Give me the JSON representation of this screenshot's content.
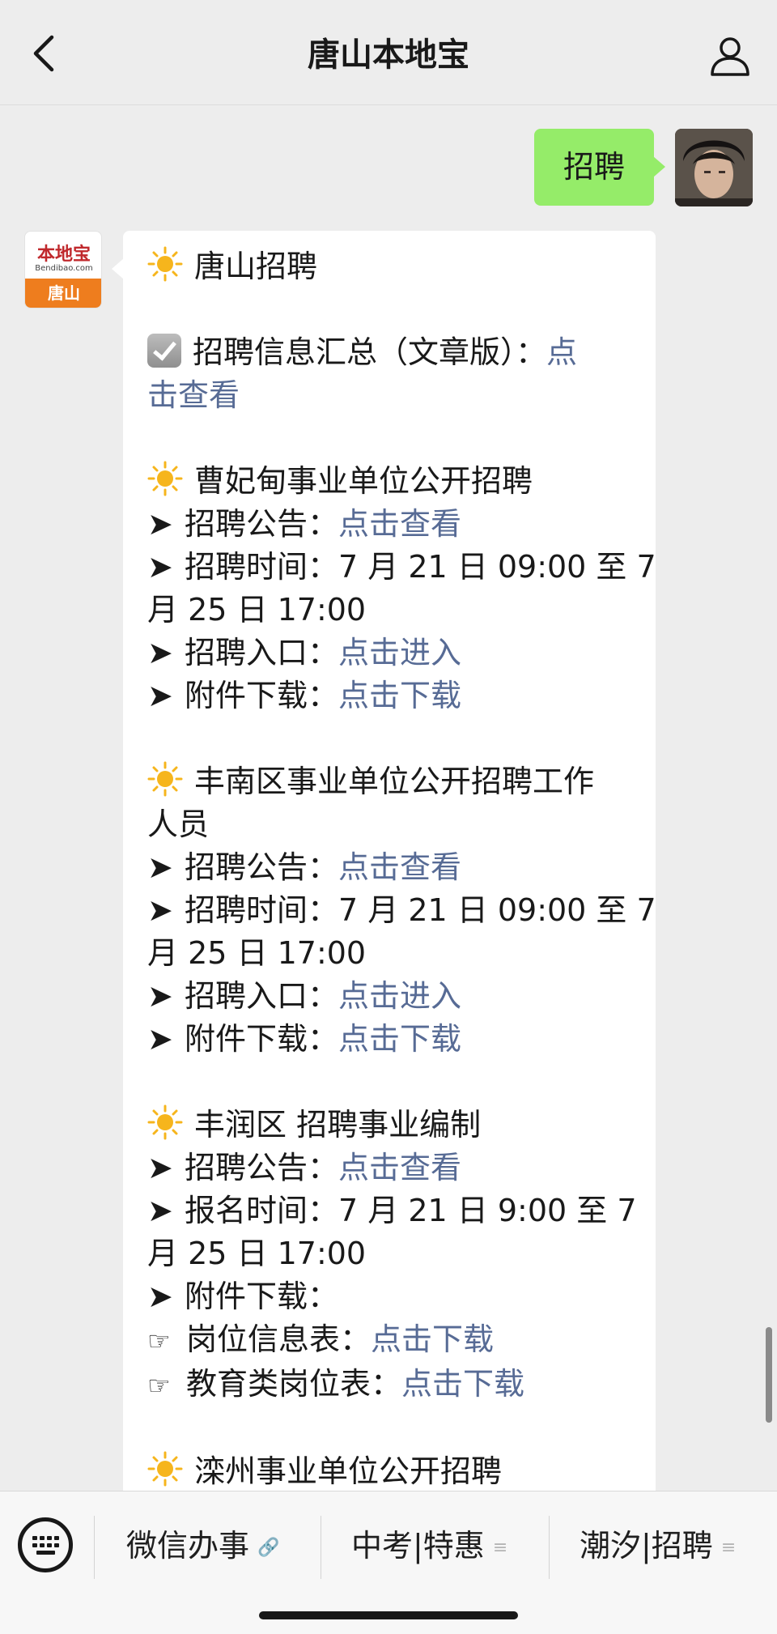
{
  "header": {
    "title": "唐山本地宝",
    "back_icon": "chevron-left-icon",
    "profile_icon": "person-icon"
  },
  "outgoing_message": {
    "text": "招聘"
  },
  "brand_avatar": {
    "top": "本地宝",
    "url": "Bendibao.com",
    "bottom": "唐山"
  },
  "message": {
    "title": "唐山招聘",
    "summary": {
      "label": "招聘信息汇总（文章版）：",
      "link_1": "点",
      "link_2": "击查看"
    },
    "sections": [
      {
        "title": "曹妃甸事业单位公开招聘",
        "notice_label": "招聘公告：",
        "notice_link": "点击查看",
        "time_line_1": "招聘时间：7 月 21 日 09:00 至 7",
        "time_line_2": "月 25 日 17:00",
        "entry_label": "招聘入口：",
        "entry_link": "点击进入",
        "attach_label": "附件下载：",
        "attach_link": "点击下载"
      },
      {
        "title_line_1": "丰南区事业单位公开招聘工作",
        "title_line_2": "人员",
        "notice_label": "招聘公告：",
        "notice_link": "点击查看",
        "time_line_1": "招聘时间：7 月 21 日 09:00 至 7",
        "time_line_2": "月 25 日 17:00",
        "entry_label": "招聘入口：",
        "entry_link": "点击进入",
        "attach_label": "附件下载：",
        "attach_link": "点击下载"
      },
      {
        "title": "丰润区 招聘事业编制",
        "notice_label": "招聘公告：",
        "notice_link": "点击查看",
        "time_line_1": "报名时间：7 月 21 日 9:00 至 7",
        "time_line_2": "月 25 日 17:00",
        "attach_label": "附件下载：",
        "files": [
          {
            "label": "岗位信息表：",
            "link": "点击下载"
          },
          {
            "label": "教育类岗位表：",
            "link": "点击下载"
          }
        ]
      },
      {
        "title": "滦州事业单位公开招聘"
      }
    ]
  },
  "bottom_menu": {
    "keyboard_icon": "keyboard-icon",
    "items": [
      {
        "label": "微信办事",
        "suffix": "🔗"
      },
      {
        "label": "中考|特惠",
        "suffix": "≡"
      },
      {
        "label": "潮汐|招聘",
        "suffix": "≡"
      }
    ]
  },
  "colors": {
    "link": "#576b95",
    "outgoing_bubble": "#95ec69",
    "background": "#ededed"
  }
}
